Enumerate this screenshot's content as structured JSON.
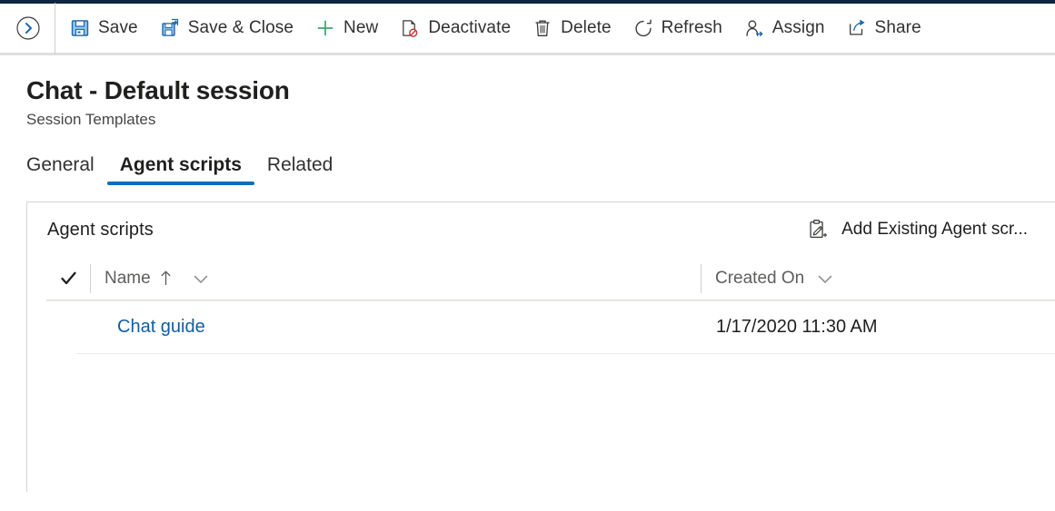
{
  "commandbar": {
    "expand_icon": "chevron-right-circle-icon",
    "buttons": [
      {
        "label": "Save",
        "icon": "save-floppy-icon"
      },
      {
        "label": "Save & Close",
        "icon": "save-and-close-icon"
      },
      {
        "label": "New",
        "icon": "plus-icon"
      },
      {
        "label": "Deactivate",
        "icon": "deactivate-page-block-icon"
      },
      {
        "label": "Delete",
        "icon": "trash-icon"
      },
      {
        "label": "Refresh",
        "icon": "refresh-circular-arrow-icon"
      },
      {
        "label": "Assign",
        "icon": "person-assign-icon"
      },
      {
        "label": "Share",
        "icon": "share-arrow-icon"
      }
    ]
  },
  "page": {
    "title": "Chat - Default session",
    "subtitle": "Session Templates"
  },
  "tabs": [
    {
      "label": "General",
      "active": false
    },
    {
      "label": "Agent scripts",
      "active": true
    },
    {
      "label": "Related",
      "active": false
    }
  ],
  "card": {
    "title": "Agent scripts",
    "action": {
      "label": "Add Existing Agent scr...",
      "icon": "add-existing-clipboard-icon"
    }
  },
  "grid": {
    "select_all_icon": "checkmark-icon",
    "columns": [
      {
        "label": "Name",
        "sort_icon": "sort-ascending-arrow-icon",
        "menu_icon": "chevron-down-icon"
      },
      {
        "label": "Created On",
        "menu_icon": "chevron-down-icon"
      }
    ],
    "rows": [
      {
        "name": "Chat guide",
        "created_on": "1/17/2020 11:30 AM"
      }
    ]
  },
  "colors": {
    "accent": "#0f6cbd",
    "link": "#115ea3",
    "icon_blue": "#2266a5",
    "icon_fill": "#8fc7ef",
    "green": "#3aa675",
    "red": "#d13438",
    "top_strip": "#0f2541"
  }
}
